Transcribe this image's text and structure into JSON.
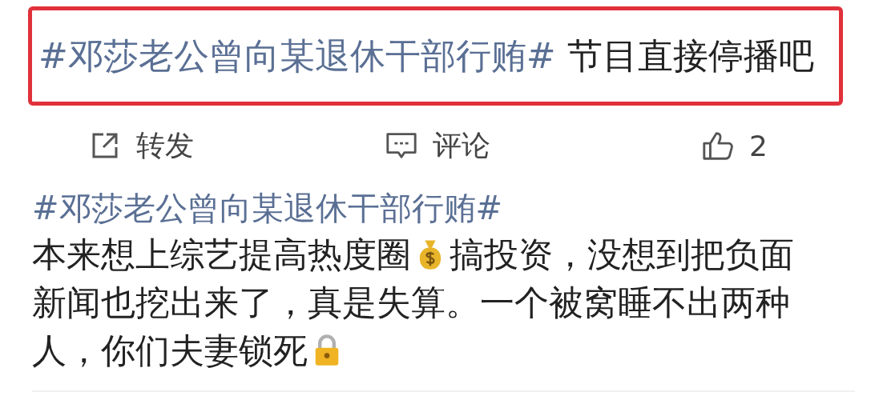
{
  "quoted_post": {
    "topic": "#邓莎老公曾向某退休干部行贿#",
    "text": "节目直接停播吧",
    "highlighted": true
  },
  "actions": [
    {
      "kind": "repost",
      "label": "转发"
    },
    {
      "kind": "comment",
      "label": "评论"
    },
    {
      "kind": "like",
      "label": "2"
    }
  ],
  "reply": {
    "topic": "#邓莎老公曾向某退休干部行贿#",
    "lines": [
      [
        {
          "kind": "text",
          "text": "本来想上综艺提高热度圈"
        },
        {
          "kind": "money_bag"
        },
        {
          "kind": "text",
          "text": "搞投资，没想到把负面"
        }
      ],
      [
        {
          "kind": "text",
          "text": "新闻也挖出来了，真是失算。一个被窝睡不出两种"
        }
      ],
      [
        {
          "kind": "text",
          "text": "人，你们夫妻锁死"
        },
        {
          "kind": "lock"
        }
      ]
    ]
  }
}
